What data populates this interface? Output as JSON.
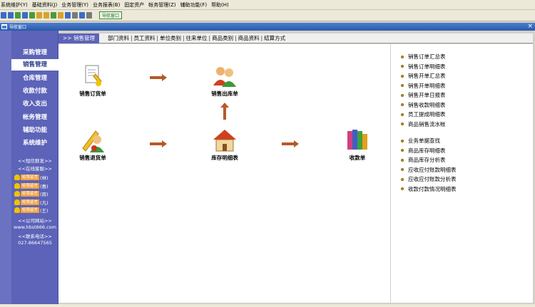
{
  "menubar": {
    "items": [
      "系统维护(Y)",
      "基础资料(J)",
      "业务管理(Y)",
      "业务报表(B)",
      "固定资产",
      "帐务管理(Z)",
      "辅助功能(F)",
      "帮助(H)"
    ]
  },
  "toolbar": {
    "nav_button": "导航窗口"
  },
  "window": {
    "title": "导航窗口",
    "close": "×"
  },
  "sidebar": {
    "items": [
      "采购管理",
      "销售管理",
      "仓库管理",
      "收款付款",
      "收入支出",
      "帐务管理",
      "辅助功能",
      "系统维护"
    ],
    "active_index": 1,
    "links": {
      "sms": "<<短信群发>>",
      "online_service": "<<在线客服>>",
      "website": "<<公司网站>>",
      "url": "www.hbst666.com",
      "contact": "<<联系电话>>",
      "phone": "027-86647565"
    },
    "qq_tag": "给我留言",
    "qq_contacts": [
      "(林)",
      "(惠)",
      "(周)",
      "(凡)",
      "(王)"
    ]
  },
  "tabs": {
    "active": ">> 销售管理",
    "links": [
      "部门资料",
      "员工资料",
      "单位类别",
      "往来单位",
      "商品类别",
      "商品资料",
      "结算方式"
    ]
  },
  "flow": {
    "nodes": {
      "sales_order": "销售订货单",
      "sales_out": "销售出库单",
      "sales_return": "销售退货单",
      "inventory": "库存明细表",
      "receipt": "收款单"
    }
  },
  "reports": {
    "group1": [
      "销售订单汇总表",
      "销售订单明细表",
      "销售开单汇总表",
      "销售开单明细表",
      "销售开单日报表",
      "销售收款明细表",
      "员工提成明细表",
      "商品销售流水帐"
    ],
    "group2": [
      "业务单据查找",
      "商品库存明细表",
      "商品库存分析表",
      "应收应付账款明细表",
      "应收应付账款分析表",
      "收款付款情况明细表"
    ]
  },
  "colors": {
    "sidebar": "#5c63b8",
    "arrow": "#b65a2a",
    "titlebar": "#2a5aa8"
  }
}
